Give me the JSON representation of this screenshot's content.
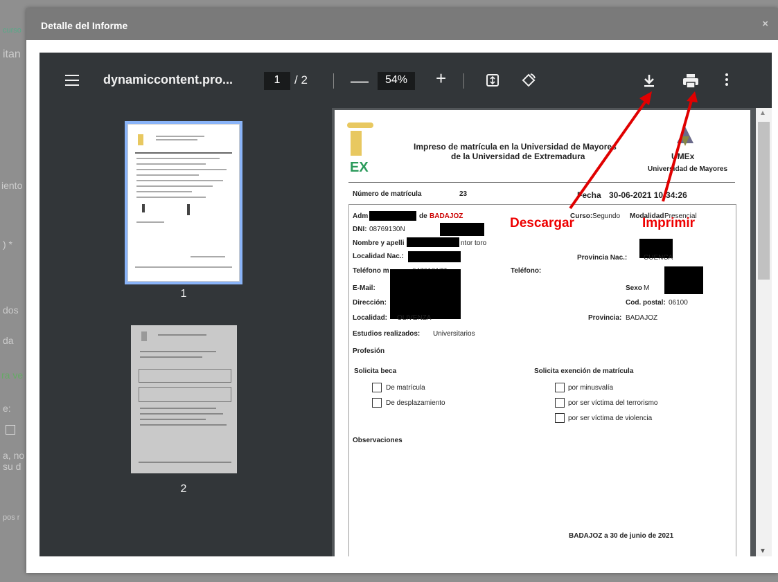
{
  "background": {
    "texts": [
      "curso",
      "itan",
      "iento",
      ") *",
      "dos",
      "da",
      "ra ve",
      "e:",
      "a, no",
      "su d",
      "pos r"
    ]
  },
  "modal": {
    "title": "Detalle del Informe",
    "close": "×"
  },
  "viewer": {
    "doc_title": "dynamiccontent.pro...",
    "current_page": "1",
    "page_sep": "/",
    "total_pages": "2",
    "zoom_out": "—",
    "zoom": "54%",
    "zoom_in": "+",
    "thumbnails": [
      {
        "label": "1"
      },
      {
        "label": "2"
      }
    ]
  },
  "document": {
    "title_line1": "Impreso de matrícula en la Universidad de Mayores",
    "title_line2": "de la Universidad de Extremadura",
    "logo_right": "UMEx",
    "logo_right_sub": "Universidad de Mayores",
    "num_label": "Número de matrícula",
    "num_value": "23",
    "fecha_label": "Fecha",
    "fecha_value": "30-06-2021 10:34:26",
    "adm_label_start": "Adm",
    "adm_label_end": "de",
    "adm_city": "BADAJOZ",
    "curso_label": "Curso:",
    "curso_value": "Segundo",
    "modalidad_label": "Modalidad",
    "modalidad_value": "Presencial",
    "dni_label": "DNI:",
    "dni_value": "08769130N",
    "nombre_label": "Nombre y apelli",
    "nombre_value": "ntor toro",
    "localidad_nac_label": "Localidad Nac.:",
    "provincia_nac_label": "Provincia Nac.:",
    "provincia_nac_value": "CUENCA",
    "telefono_movil_label": "Teléfono m",
    "telefono_movil_value": "647610177",
    "telefono_label": "Teléfono:",
    "email_label": "E-Mail:",
    "sexo_label": "Sexo",
    "sexo_value": "M",
    "direccion_label": "Dirección:",
    "cod_postal_label": "Cod. postal:",
    "cod_postal_value": "06100",
    "localidad_label": "Localidad:",
    "localidad_value": "OLIVENZA",
    "provincia_label": "Provincia:",
    "provincia_value": "BADAJOZ",
    "estudios_label": "Estudios realizados:",
    "estudios_value": "Universitarios",
    "profesion_label": "Profesión",
    "beca_label": "Solicita beca",
    "beca_options": [
      "De matrícula",
      "De desplazamiento"
    ],
    "exencion_label": "Solicita exención de matrícula",
    "exencion_options": [
      "por minusvalía",
      "por ser víctima del terrorismo",
      "por ser víctima de violencia"
    ],
    "observaciones_label": "Observaciones",
    "footer": "BADAJOZ a 30 de junio de 2021"
  },
  "annotations": {
    "descargar": "Descargar",
    "imprimir": "Imprimir"
  },
  "colors": {
    "annotation": "#e00000",
    "toolbar": "#323639",
    "viewer_bg": "#525659",
    "thumb_highlight": "#8ab4f8"
  }
}
